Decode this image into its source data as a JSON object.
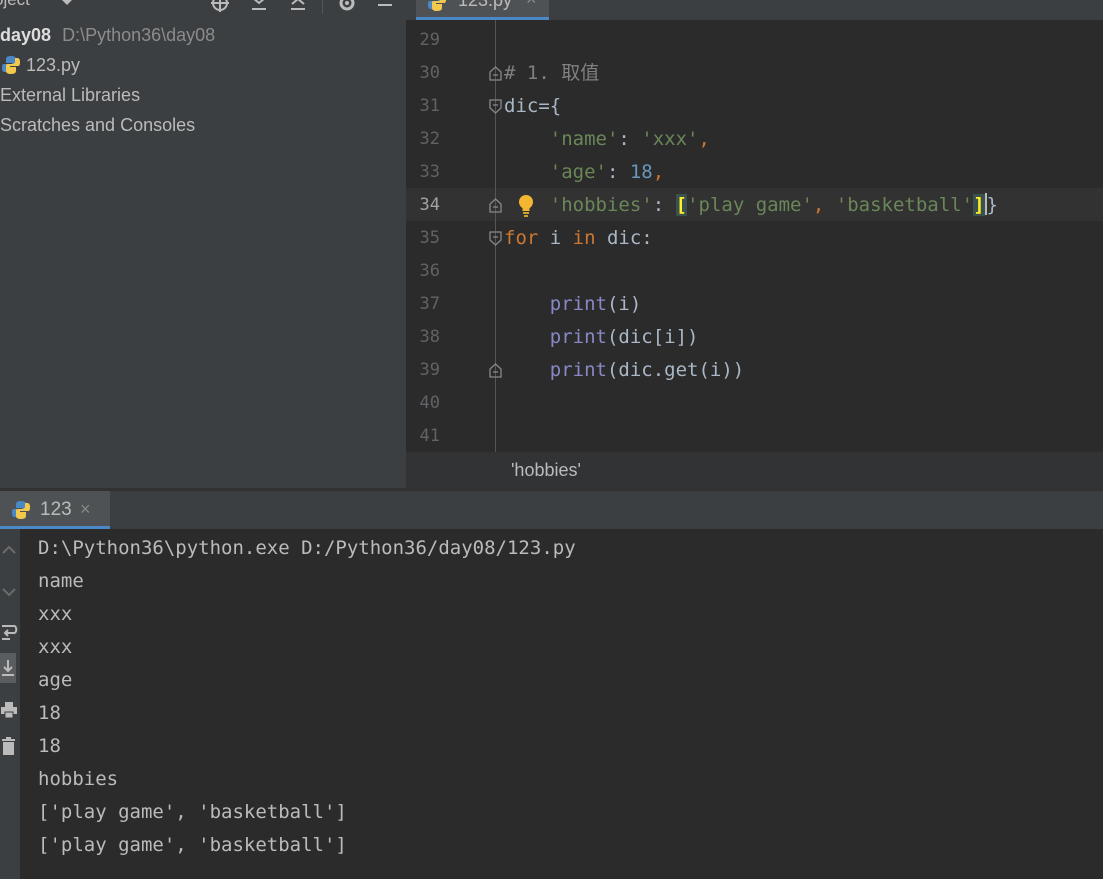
{
  "project": {
    "title": "oject",
    "tree": {
      "root_name": "day08",
      "root_path": "D:\\Python36\\day08",
      "file": "123.py",
      "external_libraries": "External Libraries",
      "scratches": "Scratches and Consoles"
    },
    "icons": [
      "dropdown-arrow-icon",
      "locate-icon",
      "expand-all-icon",
      "collapse-all-icon",
      "gear-icon",
      "minimize-icon"
    ]
  },
  "editor": {
    "tab": {
      "label": "123.py",
      "close": "×"
    },
    "line_numbers": [
      "29",
      "30",
      "31",
      "32",
      "33",
      "34",
      "35",
      "36",
      "37",
      "38",
      "39",
      "40",
      "41"
    ],
    "current_line": "34",
    "code": {
      "l30": {
        "hash": "# ",
        "num": "1.",
        "text": " 取值"
      },
      "l31": {
        "name": "dic",
        "rest": "={"
      },
      "l32": {
        "indent": "    ",
        "key": "'name'",
        "colon": ": ",
        "val": "'xxx'",
        "comma": ","
      },
      "l33": {
        "indent": "    ",
        "key": "'age'",
        "colon": ": ",
        "val": "18",
        "comma": ","
      },
      "l34": {
        "indent": "    ",
        "key": "'hobbies'",
        "colon": ": ",
        "open": "[",
        "v1": "'play game'",
        "sep": ", ",
        "v2": "'basketball'",
        "close": "]",
        "end": "}"
      },
      "l35": {
        "kw1": "for",
        "mid1": " i ",
        "kw2": "in",
        "mid2": " dic:"
      },
      "l37": {
        "indent": "    ",
        "fn": "print",
        "args": "(i)"
      },
      "l38": {
        "indent": "    ",
        "fn": "print",
        "args": "(dic[i])"
      },
      "l39": {
        "indent": "    ",
        "fn": "print",
        "args": "(dic.get(i))"
      }
    },
    "breadcrumb": "'hobbies'"
  },
  "run": {
    "tab": {
      "label": "123",
      "close": "×"
    },
    "toolbar_icons": [
      "up-arrow-icon",
      "down-arrow-icon",
      "soft-wrap-icon",
      "scroll-to-end-icon",
      "print-icon",
      "trash-icon"
    ],
    "output": [
      "D:\\Python36\\python.exe D:/Python36/day08/123.py",
      "name",
      "xxx",
      "xxx",
      "age",
      "18",
      "18",
      "hobbies",
      "['play game', 'basketball']",
      "['play game', 'basketball']"
    ]
  },
  "colors": {
    "panel_bg": "#3c3f41",
    "editor_bg": "#2b2b2b",
    "keyword": "#cc7832",
    "string": "#6a8759",
    "number": "#6897bb",
    "builtin": "#8888c6",
    "bracket_highlight": "#ffef28",
    "tab_underline": "#4a88c7"
  }
}
